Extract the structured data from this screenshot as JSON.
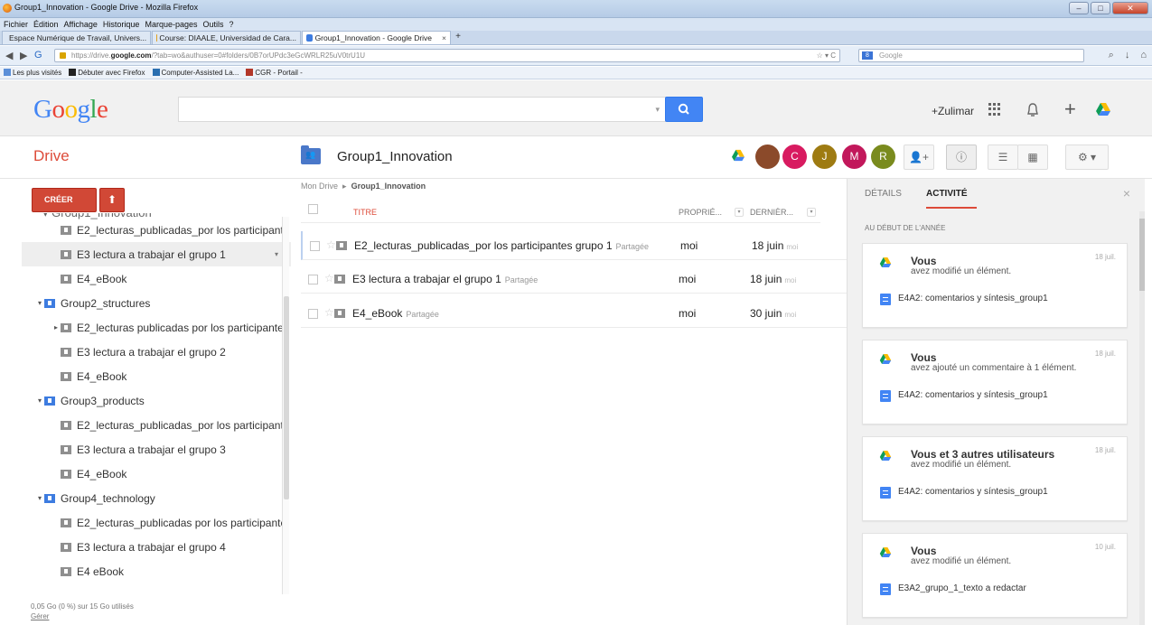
{
  "browser": {
    "window_title": "Group1_Innovation - Google Drive - Mozilla Firefox",
    "menu": [
      "Fichier",
      "Édition",
      "Affichage",
      "Historique",
      "Marque-pages",
      "Outils",
      "?"
    ],
    "tabs": [
      {
        "label": "Espace Numérique de Travail, Univers...",
        "color": "#6fa84a"
      },
      {
        "label": "Course: DIAALE, Universidad de Cara...",
        "color": "#e0a020"
      },
      {
        "label": "Group1_Innovation - Google Drive",
        "color": "#3d7ce0"
      }
    ],
    "url_prefix": "https://drive.",
    "url_host": "google.com",
    "url_rest": "/?tab=wo&authuser=0#folders/0B7orUPdc3eGcWRLR25uV0trU1U",
    "search_engine": "Google",
    "bookmarks": [
      "Les plus visités",
      "Débuter avec Firefox",
      "Computer-Assisted La...",
      "CGR - Portail -"
    ]
  },
  "google": {
    "logo": "Google",
    "user": "+Zulimar"
  },
  "drive": {
    "label": "Drive",
    "folder_title": "Group1_Innovation",
    "avatars": [
      {
        "letter": "C",
        "color": "#d81b60"
      },
      {
        "letter": "J",
        "color": "#9e7b12"
      },
      {
        "letter": "M",
        "color": "#c2185b"
      },
      {
        "letter": "R",
        "color": "#7a8b1e"
      }
    ]
  },
  "sidebar": {
    "create_label": "CRÉER",
    "tree": [
      {
        "label": "E2_lecturas_publicadas_por los participant",
        "indent": 2,
        "color": "grey",
        "expander": ""
      },
      {
        "label": "E3 lectura a trabajar el grupo 1",
        "indent": 2,
        "color": "grey",
        "expander": "",
        "selected": true
      },
      {
        "label": "E4_eBook",
        "indent": 2,
        "color": "grey",
        "expander": ""
      },
      {
        "label": "Group2_structures",
        "indent": 1,
        "color": "blue",
        "expander": "▾"
      },
      {
        "label": "E2_lecturas publicadas por los participante",
        "indent": 2,
        "color": "grey",
        "expander": "▸"
      },
      {
        "label": "E3 lectura a trabajar el grupo 2",
        "indent": 2,
        "color": "grey",
        "expander": ""
      },
      {
        "label": "E4_eBook",
        "indent": 2,
        "color": "grey",
        "expander": ""
      },
      {
        "label": "Group3_products",
        "indent": 1,
        "color": "blue",
        "expander": "▾"
      },
      {
        "label": "E2_lecturas_publicadas_por los participant",
        "indent": 2,
        "color": "grey",
        "expander": ""
      },
      {
        "label": "E3 lectura a trabajar el grupo 3",
        "indent": 2,
        "color": "grey",
        "expander": ""
      },
      {
        "label": "E4_eBook",
        "indent": 2,
        "color": "grey",
        "expander": ""
      },
      {
        "label": "Group4_technology",
        "indent": 1,
        "color": "blue",
        "expander": "▾"
      },
      {
        "label": "E2_lecturas_publicadas por los participante",
        "indent": 2,
        "color": "grey",
        "expander": ""
      },
      {
        "label": "E3 lectura a trabajar el grupo 4",
        "indent": 2,
        "color": "grey",
        "expander": ""
      },
      {
        "label": "E4 eBook",
        "indent": 2,
        "color": "grey",
        "expander": ""
      }
    ],
    "storage_text": "0,05 Go (0 %) sur 15 Go utilisés",
    "manage_link": "Gérer"
  },
  "main": {
    "breadcrumb_root": "Mon Drive",
    "breadcrumb_sep": "▸",
    "breadcrumb_current": "Group1_Innovation",
    "col_title": "TITRE",
    "col_owner": "PROPRIÉ...",
    "col_modified": "DERNIÈR...",
    "files": [
      {
        "name": "E2_lecturas_publicadas_por los participantes grupo 1",
        "shared": "Partagée",
        "owner": "moi",
        "date": "18 juin",
        "by": "moi"
      },
      {
        "name": "E3 lectura a trabajar el grupo 1",
        "shared": "Partagée",
        "owner": "moi",
        "date": "18 juin",
        "by": "moi"
      },
      {
        "name": "E4_eBook",
        "shared": "Partagée",
        "owner": "moi",
        "date": "30 juin",
        "by": "moi"
      }
    ]
  },
  "panel": {
    "tab_details": "DÉTAILS",
    "tab_activity": "ACTIVITÉ",
    "section": "AU DÉBUT DE L'ANNÉE",
    "cards": [
      {
        "who": "Vous",
        "what": "avez modifié un élément.",
        "date": "18 juil.",
        "doc": "E4A2: comentarios y síntesis_group1"
      },
      {
        "who": "Vous",
        "what": "avez ajouté un commentaire à 1 élément.",
        "date": "18 juil.",
        "doc": "E4A2: comentarios y síntesis_group1"
      },
      {
        "who": "Vous et 3 autres utilisateurs",
        "what": "avez modifié un élément.",
        "date": "18 juil.",
        "doc": "E4A2: comentarios y síntesis_group1"
      },
      {
        "who": "Vous",
        "what": "avez modifié un élément.",
        "date": "10 juil.",
        "doc": "E3A2_grupo_1_texto a redactar"
      }
    ]
  },
  "colors": {
    "accent_red": "#dd4b39",
    "google_blue": "#4285f4",
    "folder_blue": "#3d7ce0"
  }
}
